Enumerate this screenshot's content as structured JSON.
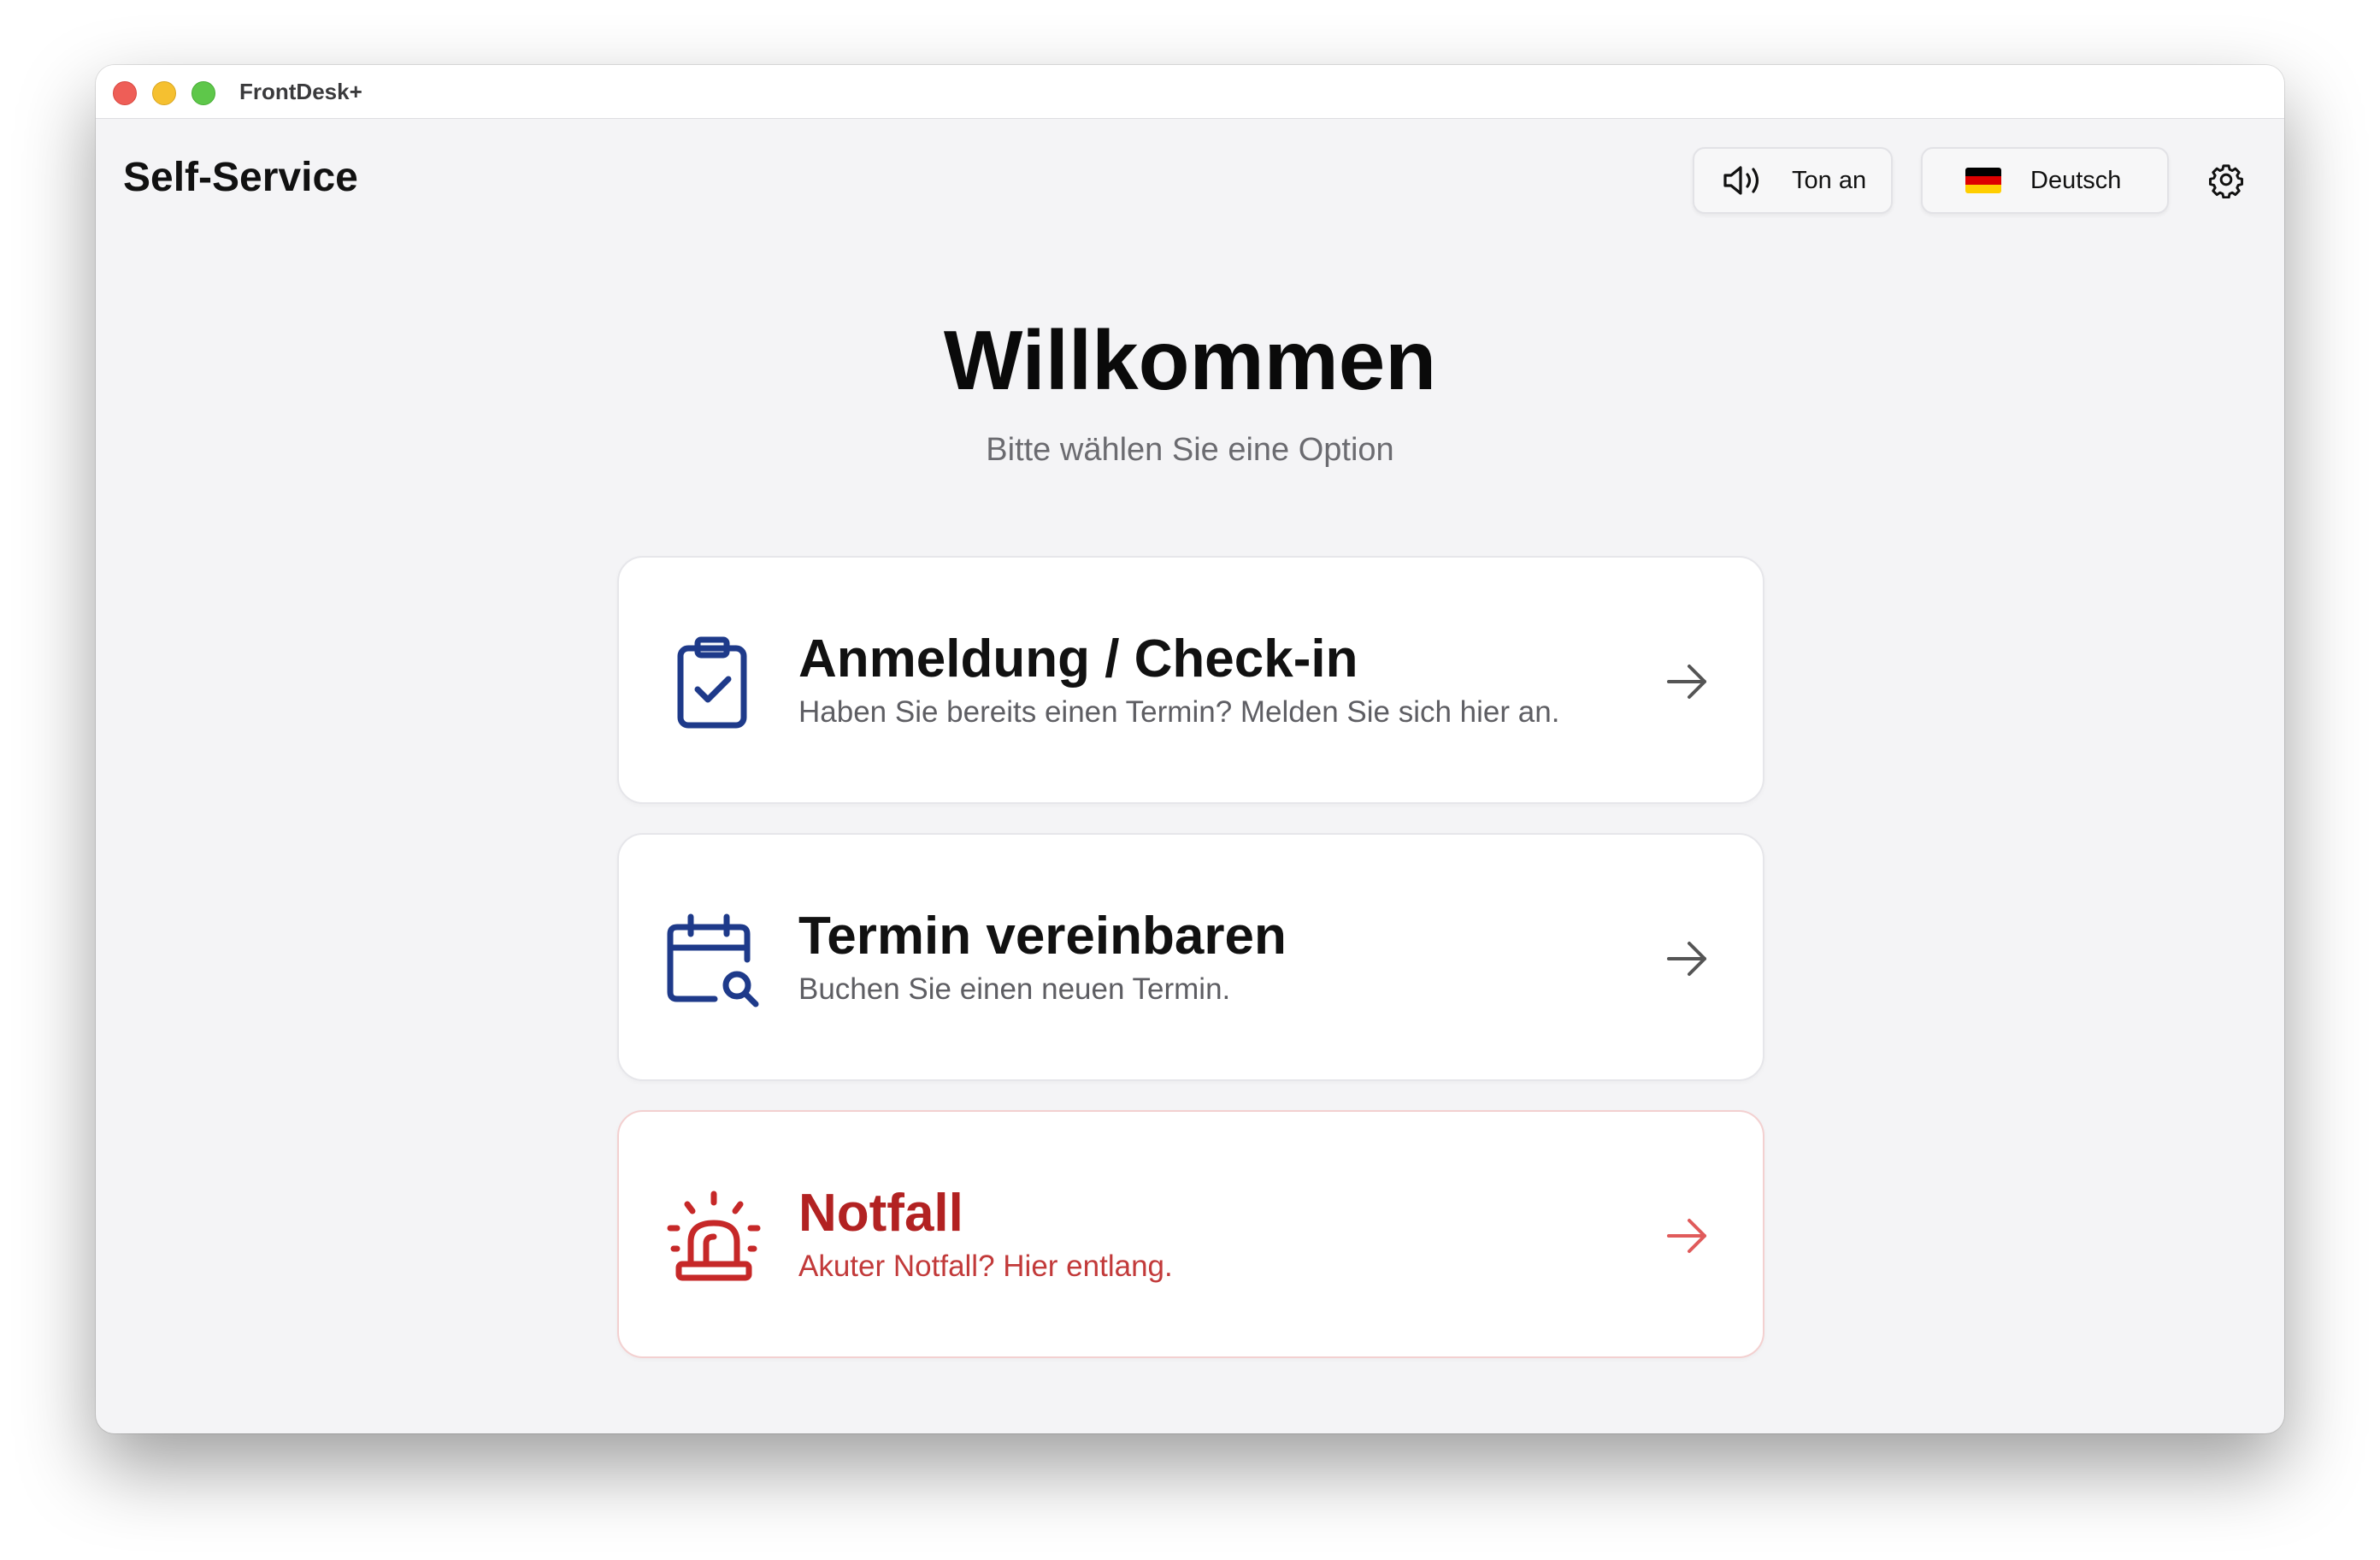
{
  "window": {
    "app_title": "FrontDesk+"
  },
  "header": {
    "title": "Self-Service",
    "sound_button": {
      "label": "Ton an",
      "icon": "speaker-icon"
    },
    "language_button": {
      "label": "Deutsch",
      "icon": "german-flag-icon"
    },
    "settings_icon": "gear-icon"
  },
  "main": {
    "heading": "Willkommen",
    "subheading": "Bitte wählen Sie eine Option"
  },
  "options": [
    {
      "title": "Anmeldung / Check-in",
      "description": "Haben Sie bereits einen Termin? Melden Sie sich hier an.",
      "icon": "clipboard-check-icon",
      "color": "#1e3a8a"
    },
    {
      "title": "Termin vereinbaren",
      "description": "Buchen Sie einen neuen Termin.",
      "icon": "calendar-search-icon",
      "color": "#1e3a8a"
    },
    {
      "title": "Notfall",
      "description": "Akuter Notfall? Hier entlang.",
      "icon": "emergency-siren-icon",
      "color": "#c62828"
    }
  ],
  "colors": {
    "background": "#f4f4f6",
    "accent_blue": "#1e3a8a",
    "emergency_red": "#c62828"
  }
}
